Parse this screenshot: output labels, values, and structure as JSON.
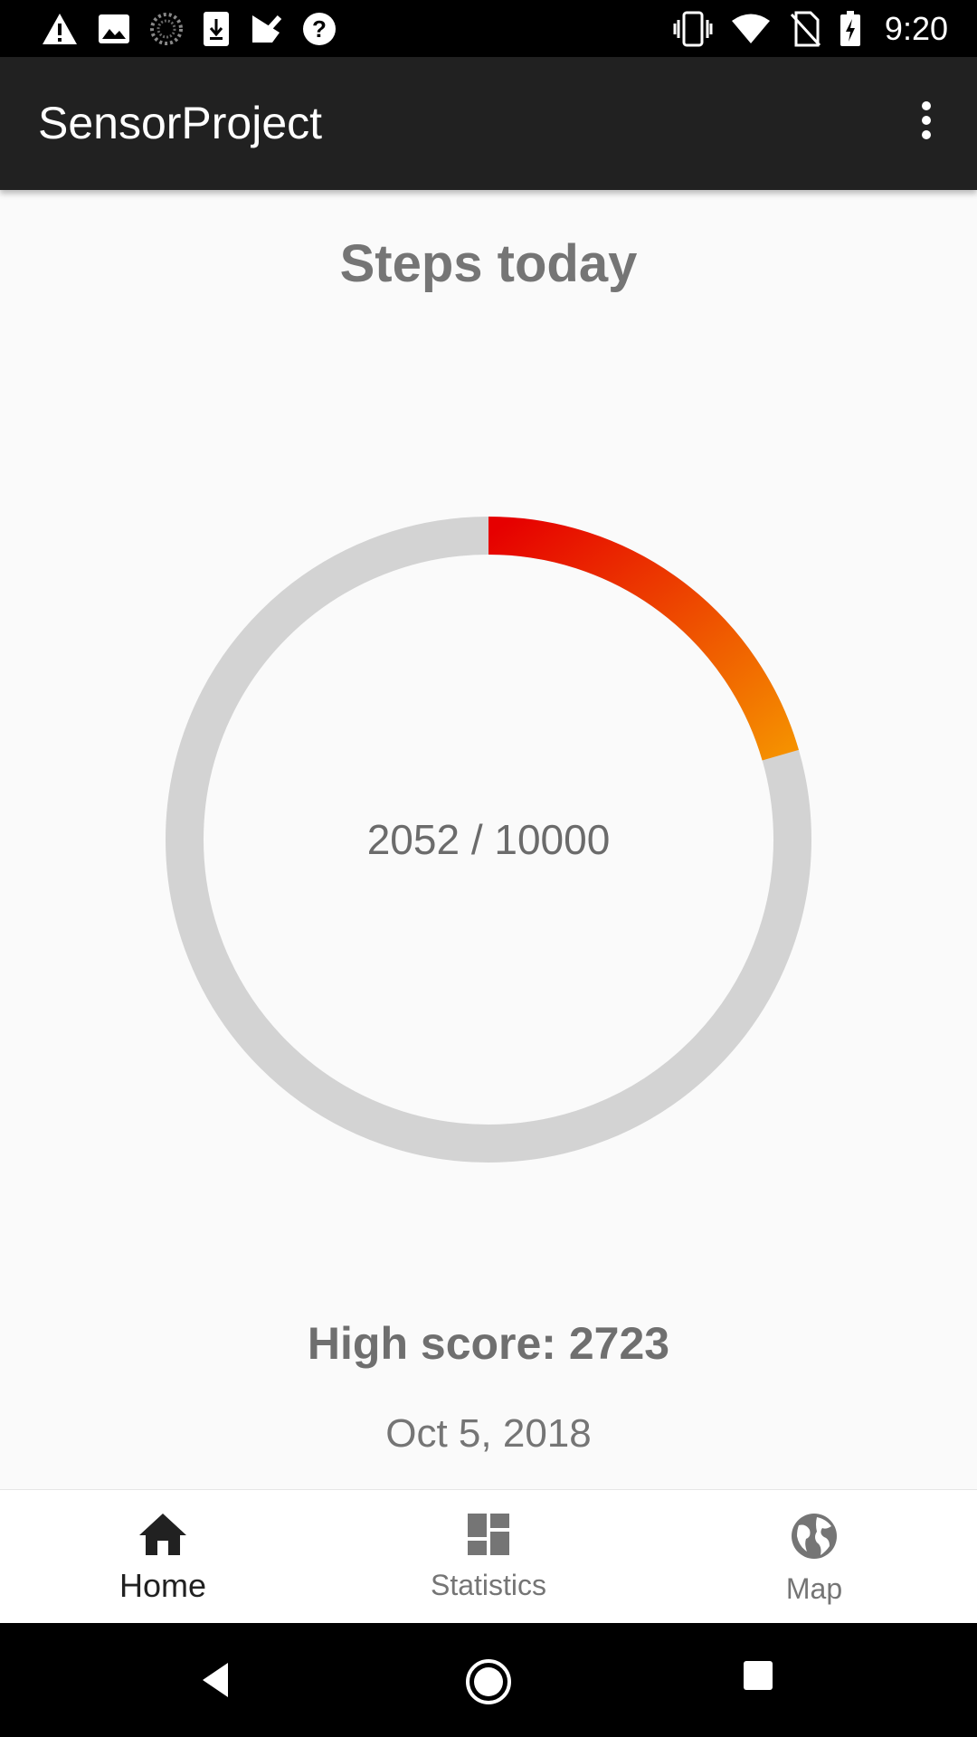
{
  "status_bar": {
    "time": "9:20",
    "left_icons": [
      "warning-icon",
      "image-icon",
      "loading-icon",
      "download-icon",
      "check-icon",
      "help-icon"
    ],
    "right_icons": [
      "vibrate-icon",
      "wifi-icon",
      "no-sim-icon",
      "battery-charging-icon"
    ]
  },
  "app_bar": {
    "title": "SensorProject",
    "overflow_icon": "more-vert-icon"
  },
  "main": {
    "title": "Steps today",
    "progress": {
      "steps": 2052,
      "goal": 10000,
      "label": "2052 / 10000",
      "colors": {
        "track": "#d3d3d3",
        "start": "#e60000",
        "end": "#f59000"
      }
    },
    "high_score_label": "High score: 2723",
    "date": "Oct 5, 2018"
  },
  "bottom_nav": {
    "items": [
      {
        "label": "Home",
        "icon": "home-icon",
        "active": true
      },
      {
        "label": "Statistics",
        "icon": "dashboard-icon",
        "active": false
      },
      {
        "label": "Map",
        "icon": "globe-icon",
        "active": false
      }
    ]
  },
  "system_nav": {
    "buttons": [
      "back-icon",
      "home-circle-icon",
      "recents-icon"
    ]
  }
}
